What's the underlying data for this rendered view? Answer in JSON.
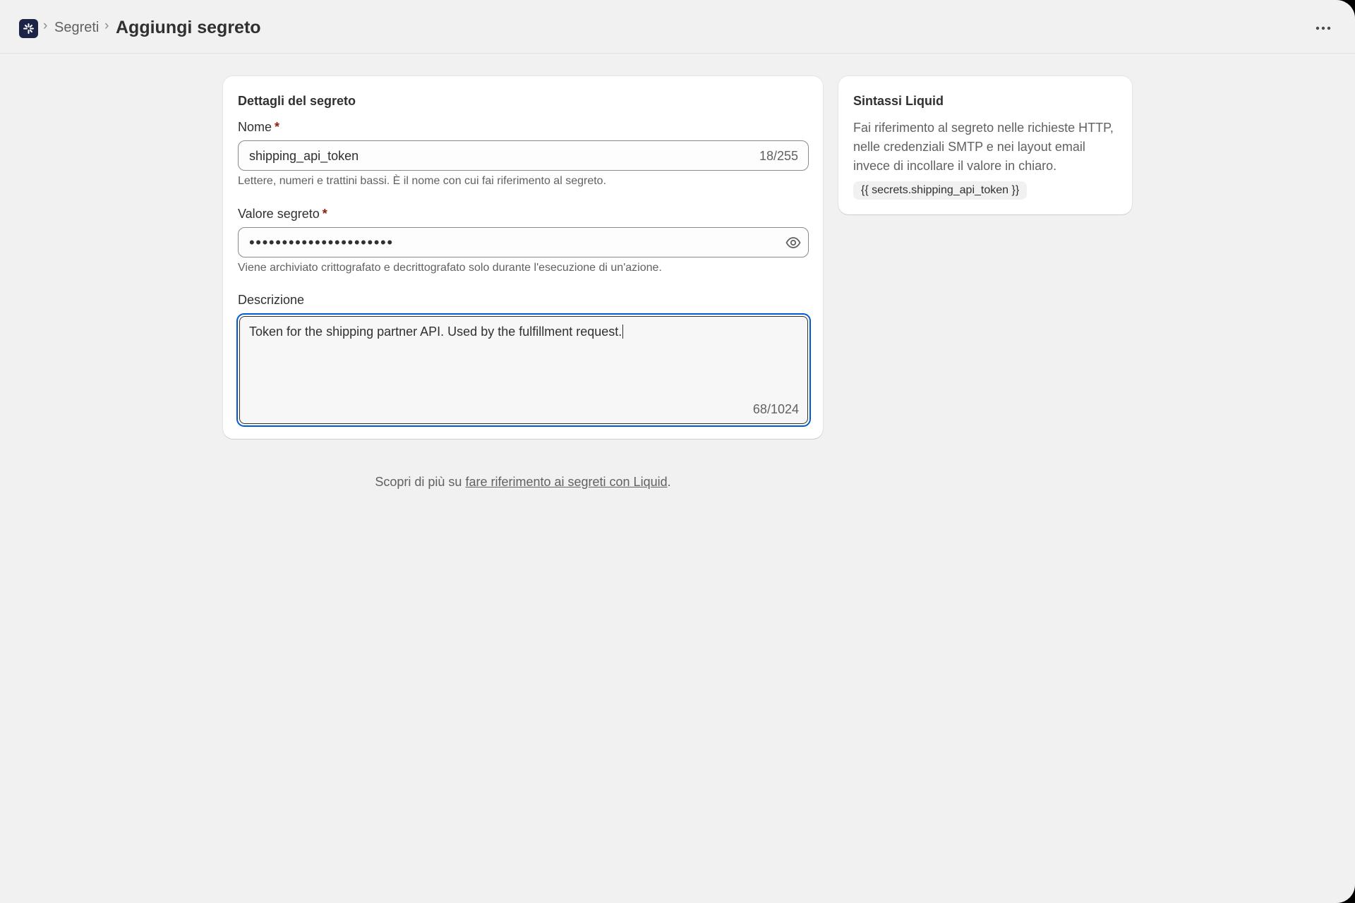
{
  "header": {
    "breadcrumb_parent": "Segreti",
    "breadcrumb_separator": "›",
    "title": "Aggiungi segreto",
    "more_icon": "ellipsis-horizontal-icon"
  },
  "main_card": {
    "title": "Dettagli del segreto",
    "name_field": {
      "label": "Nome",
      "required_marker": "*",
      "value": "shipping_api_token",
      "counter": "18/255",
      "help": "Lettere, numeri e trattini bassi. È il nome con cui fai riferimento al segreto."
    },
    "secret_field": {
      "label": "Valore segreto",
      "required_marker": "*",
      "masked_value": "••••••••••••••••••••••",
      "reveal_icon": "eye-icon",
      "help": "Viene archiviato crittografato e decrittografato solo durante l'esecuzione di un'azione."
    },
    "description_field": {
      "label": "Descrizione",
      "value": "Token for the shipping partner API. Used by the fulfillment request.",
      "counter": "68/1024"
    }
  },
  "side_card": {
    "title": "Sintassi Liquid",
    "body": "Fai riferimento al segreto nelle richieste HTTP, nelle credenziali SMTP e nei layout email invece di incollare il valore in chiaro.",
    "code": "{{ secrets.shipping_api_token }}"
  },
  "footer": {
    "prefix": "Scopri di più su ",
    "link": "fare riferimento ai segreti con Liquid",
    "suffix": "."
  },
  "colors": {
    "background": "#f1f1f1",
    "focus_ring": "#005bd3",
    "required": "#8e1f0b",
    "logo_bg": "#1d2346"
  }
}
